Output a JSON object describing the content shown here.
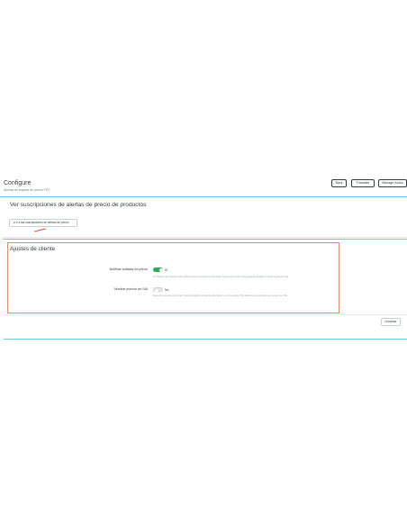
{
  "header": {
    "title": "Configure",
    "subtitle": "Alertas de bajada de precio TPC",
    "buttons": [
      "Back",
      "Translate",
      "Manage hooks"
    ]
  },
  "subscriptions_panel": {
    "title": "Ver suscripciones de alertas de precio de productos",
    "link_label": "Ir a las suscripciones de alertas de precio"
  },
  "settings": {
    "title": "Ajustes de cliente",
    "rows": [
      {
        "label": "Notificar subidas de precio",
        "state": "Sí",
        "enabled": true,
        "help": "Por defecto los clientes solo reciben avisos cuando el precio baja. Activa esta opción para avisarles también cuando el precio suba."
      },
      {
        "label": "Mostrar precios sin IVA",
        "state": "No",
        "enabled": false,
        "help": "Muestra nuestros precios sin IVA en la página de alertas del cliente y en los emails. Por defecto usa la versión con precio con IVA."
      }
    ]
  },
  "footer": {
    "save_label": "Guardar"
  },
  "colors": {
    "accent": "#25b9d7",
    "toggle_on": "#34a853",
    "highlight_border": "#e58a72",
    "annotation": "#e03c2f"
  }
}
